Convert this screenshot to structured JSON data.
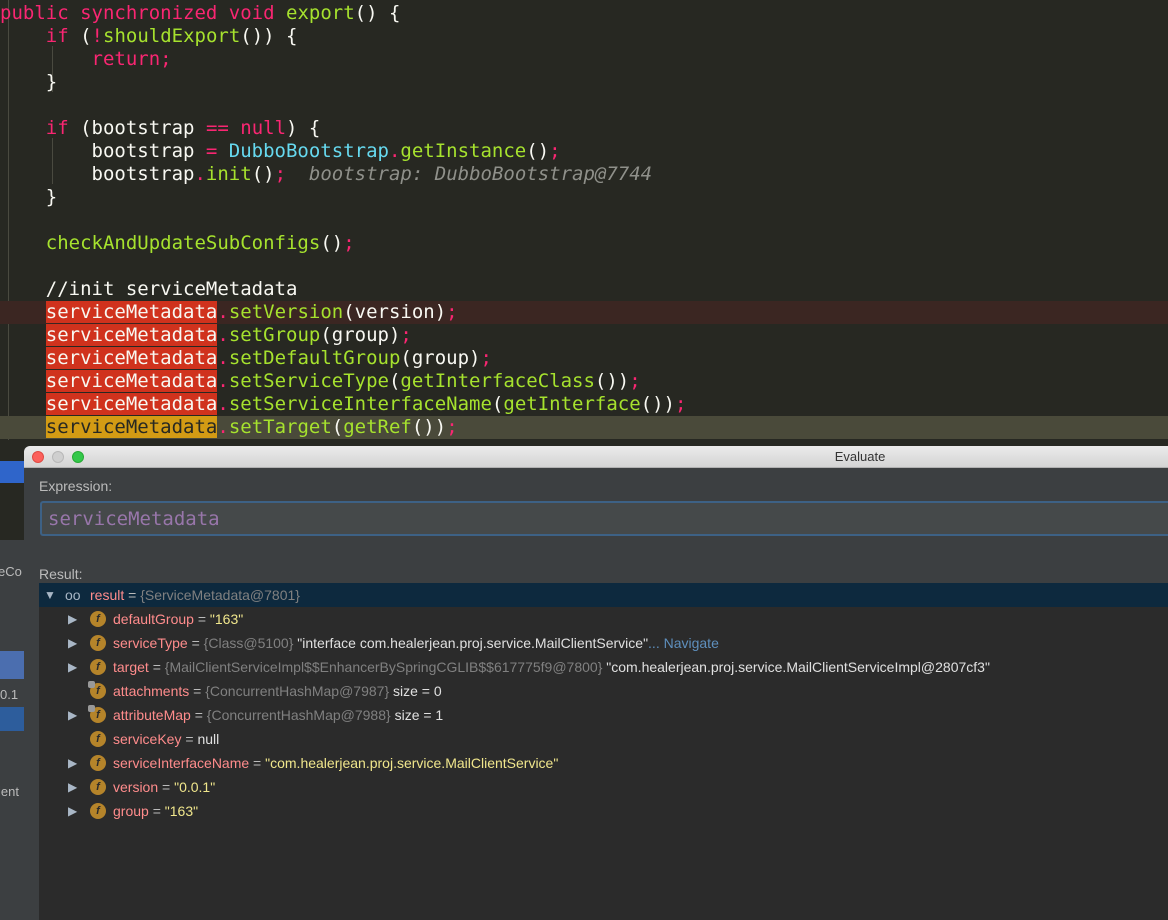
{
  "editor": {
    "lines": [
      {
        "segs": [
          [
            "kw",
            "public "
          ],
          [
            "kw",
            "synchronized "
          ],
          [
            "kw",
            "void "
          ],
          [
            "fn",
            "export"
          ],
          [
            "dim",
            "() {"
          ]
        ]
      },
      {
        "segs": [
          [
            "dim",
            "    "
          ],
          [
            "kw",
            "if "
          ],
          [
            "dim",
            "("
          ],
          [
            "op",
            "!"
          ],
          [
            "fn",
            "shouldExport"
          ],
          [
            "dim",
            "()) {"
          ]
        ]
      },
      {
        "segs": [
          [
            "dim",
            "        "
          ],
          [
            "kw",
            "return"
          ],
          [
            "op",
            ";"
          ]
        ]
      },
      {
        "segs": [
          [
            "dim",
            "    }"
          ]
        ]
      },
      {
        "segs": [
          [
            "dim",
            ""
          ]
        ]
      },
      {
        "segs": [
          [
            "dim",
            "    "
          ],
          [
            "kw",
            "if "
          ],
          [
            "dim",
            "(bootstrap "
          ],
          [
            "op",
            "== "
          ],
          [
            "kw",
            "null"
          ],
          [
            "dim",
            ") {"
          ]
        ]
      },
      {
        "segs": [
          [
            "dim",
            "        bootstrap "
          ],
          [
            "op",
            "= "
          ],
          [
            "cls",
            "DubboBootstrap"
          ],
          [
            "op",
            "."
          ],
          [
            "fn",
            "getInstance"
          ],
          [
            "dim",
            "()"
          ],
          [
            "op",
            ";"
          ]
        ]
      },
      {
        "segs": [
          [
            "dim",
            "        bootstrap"
          ],
          [
            "op",
            "."
          ],
          [
            "fn",
            "init"
          ],
          [
            "dim",
            "()"
          ],
          [
            "op",
            ";"
          ],
          [
            "dim",
            "  "
          ],
          [
            "hint",
            "bootstrap: DubboBootstrap@7744"
          ]
        ]
      },
      {
        "segs": [
          [
            "dim",
            "    }"
          ]
        ]
      },
      {
        "segs": [
          [
            "dim",
            ""
          ]
        ]
      },
      {
        "segs": [
          [
            "dim",
            "    "
          ],
          [
            "fn",
            "checkAndUpdateSubConfigs"
          ],
          [
            "dim",
            "()"
          ],
          [
            "op",
            ";"
          ]
        ]
      },
      {
        "segs": [
          [
            "dim",
            ""
          ]
        ]
      },
      {
        "segs": [
          [
            "dim",
            "    "
          ],
          [
            "cmt",
            "//init serviceMetadata"
          ]
        ]
      },
      {
        "hl": "red",
        "segs": [
          [
            "dim",
            "    "
          ],
          [
            "bp",
            "serviceMetadata"
          ],
          [
            "op",
            "."
          ],
          [
            "fn",
            "setVersion"
          ],
          [
            "dim",
            "(version)"
          ],
          [
            "op",
            ";"
          ]
        ]
      },
      {
        "segs": [
          [
            "dim",
            "    "
          ],
          [
            "bp",
            "serviceMetadata"
          ],
          [
            "op",
            "."
          ],
          [
            "fn",
            "setGroup"
          ],
          [
            "dim",
            "(group)"
          ],
          [
            "op",
            ";"
          ]
        ]
      },
      {
        "segs": [
          [
            "dim",
            "    "
          ],
          [
            "bp",
            "serviceMetadata"
          ],
          [
            "op",
            "."
          ],
          [
            "fn",
            "setDefaultGroup"
          ],
          [
            "dim",
            "(group)"
          ],
          [
            "op",
            ";"
          ]
        ]
      },
      {
        "segs": [
          [
            "dim",
            "    "
          ],
          [
            "bp",
            "serviceMetadata"
          ],
          [
            "op",
            "."
          ],
          [
            "fn",
            "setServiceType"
          ],
          [
            "dim",
            "("
          ],
          [
            "fn",
            "getInterfaceClass"
          ],
          [
            "dim",
            "())"
          ],
          [
            "op",
            ";"
          ]
        ]
      },
      {
        "segs": [
          [
            "dim",
            "    "
          ],
          [
            "bp",
            "serviceMetadata"
          ],
          [
            "op",
            "."
          ],
          [
            "fn",
            "setServiceInterfaceName"
          ],
          [
            "dim",
            "("
          ],
          [
            "fn",
            "getInterface"
          ],
          [
            "dim",
            "())"
          ],
          [
            "op",
            ";"
          ]
        ]
      },
      {
        "hl": "exec",
        "segs": [
          [
            "dim",
            "    "
          ],
          [
            "bp-exec",
            "serviceMetadata"
          ],
          [
            "op",
            "."
          ],
          [
            "fn",
            "setTarget"
          ],
          [
            "dim",
            "("
          ],
          [
            "fn",
            "getRef"
          ],
          [
            "dim",
            "())"
          ],
          [
            "op",
            ";"
          ]
        ]
      }
    ]
  },
  "under_panel": {
    "frag1": "eCo",
    "frag2": "0.1",
    "frag3": "ient"
  },
  "evaluate": {
    "window_title": "Evaluate",
    "expression_label": "Expression:",
    "expression_value": "serviceMetadata",
    "result_label": "Result:",
    "result": {
      "name": "result",
      "ref": "{ServiceMetadata@7801}"
    },
    "fields": [
      {
        "name": "defaultGroup",
        "ref": "",
        "value": "\"163\"",
        "value_kind": "str",
        "nav": "",
        "expandable": true,
        "locked": false
      },
      {
        "name": "serviceType",
        "ref": "{Class@5100}",
        "value": "\"interface com.healerjean.proj.service.MailClientService\"",
        "value_kind": "plain",
        "nav": "... Navigate",
        "expandable": true,
        "locked": false
      },
      {
        "name": "target",
        "ref": "{MailClientServiceImpl$$EnhancerBySpringCGLIB$$617775f9@7800}",
        "value": "\"com.healerjean.proj.service.MailClientServiceImpl@2807cf3\"",
        "value_kind": "plain",
        "nav": "",
        "expandable": true,
        "locked": false
      },
      {
        "name": "attachments",
        "ref": "{ConcurrentHashMap@7987}",
        "value": " size = 0",
        "value_kind": "plain",
        "nav": "",
        "expandable": false,
        "locked": true
      },
      {
        "name": "attributeMap",
        "ref": "{ConcurrentHashMap@7988}",
        "value": " size = 1",
        "value_kind": "plain",
        "nav": "",
        "expandable": true,
        "locked": true
      },
      {
        "name": "serviceKey",
        "ref": "",
        "value": "null",
        "value_kind": "plain",
        "nav": "",
        "expandable": false,
        "locked": false
      },
      {
        "name": "serviceInterfaceName",
        "ref": "",
        "value": "\"com.healerjean.proj.service.MailClientService\"",
        "value_kind": "str",
        "nav": "",
        "expandable": true,
        "locked": false
      },
      {
        "name": "version",
        "ref": "",
        "value": "\"0.0.1\"",
        "value_kind": "str",
        "nav": "",
        "expandable": true,
        "locked": false
      },
      {
        "name": "group",
        "ref": "",
        "value": "\"163\"",
        "value_kind": "str",
        "nav": "",
        "expandable": true,
        "locked": false
      }
    ]
  },
  "colors": {
    "editor_bg": "#272822",
    "breakpoint_red": "#d0321d",
    "exec_point": "#d39b14",
    "keyword": "#f92672",
    "function": "#a6e22e",
    "class": "#66d9ef"
  }
}
